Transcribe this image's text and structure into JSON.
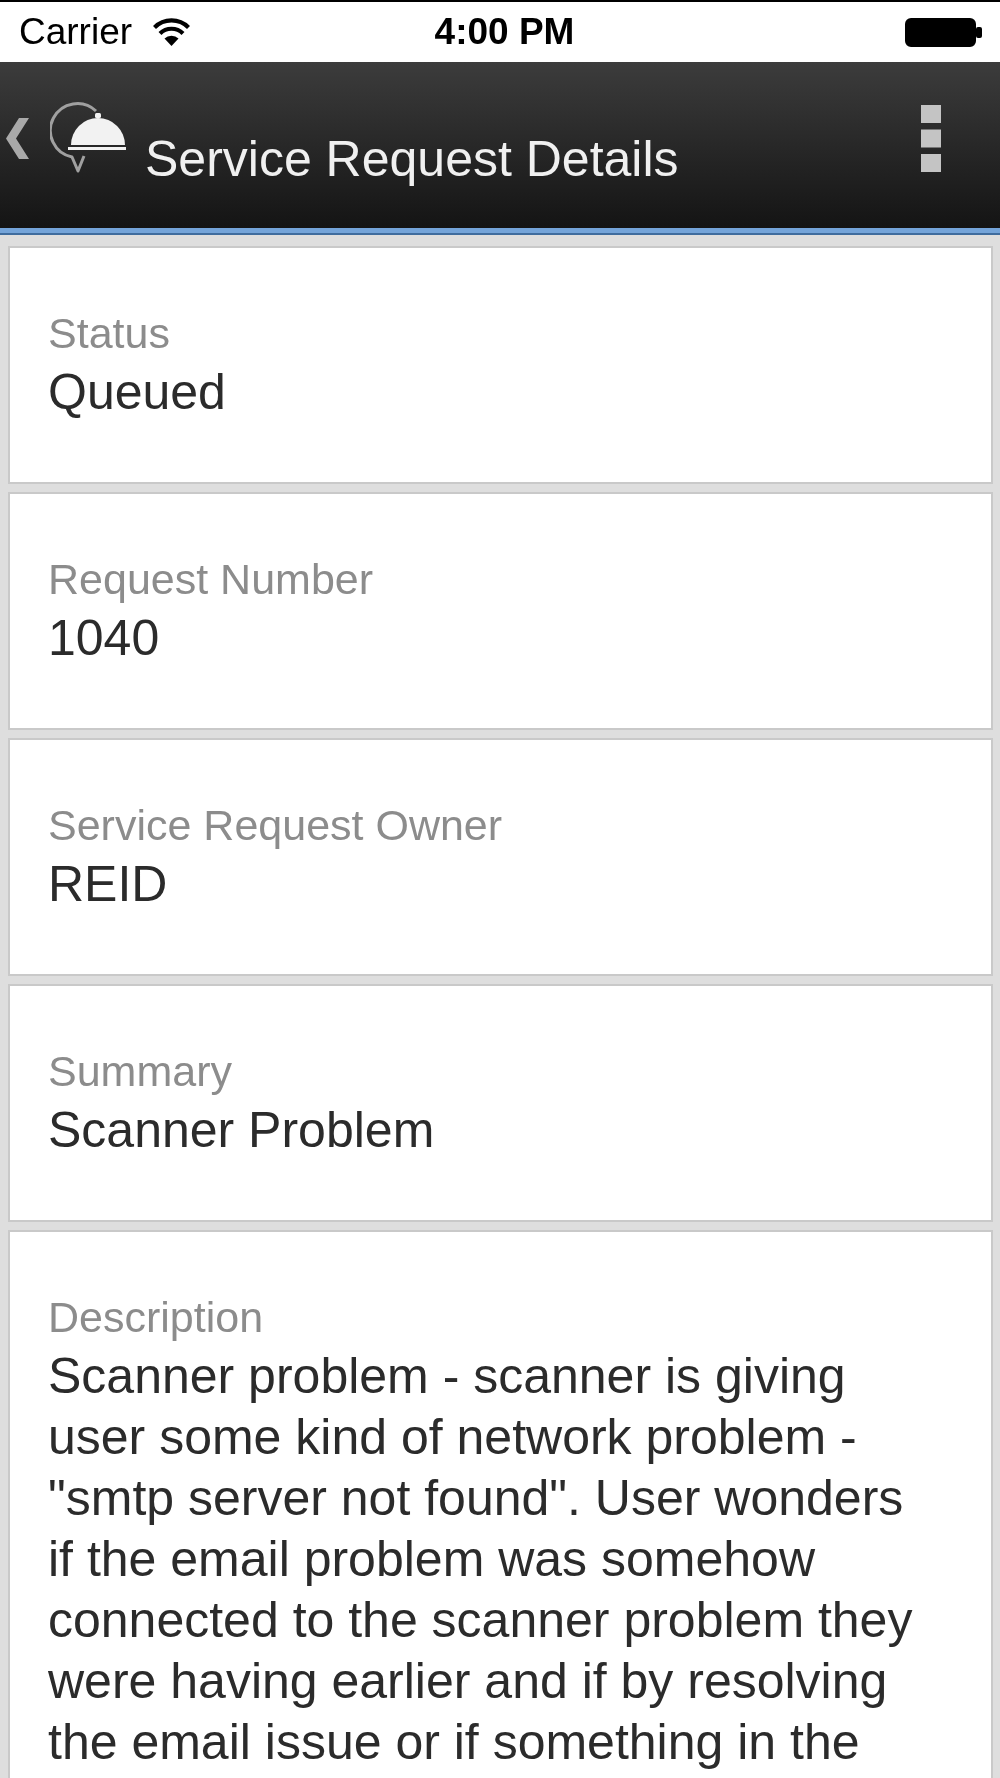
{
  "status_bar": {
    "carrier": "Carrier",
    "time": "4:00 PM"
  },
  "header": {
    "title": "Service Request Details"
  },
  "fields": [
    {
      "label": "Status",
      "value": "Queued"
    },
    {
      "label": "Request Number",
      "value": "1040"
    },
    {
      "label": "Service Request Owner",
      "value": "REID"
    },
    {
      "label": "Summary",
      "value": "Scanner Problem"
    },
    {
      "label": "Description",
      "value": "Scanner problem - scanner is giving user some kind of network problem - \"smtp server not found\". User wonders if the email problem was somehow connected to the scanner problem they were having earlier and if by resolving the email issue or if something in the"
    }
  ]
}
